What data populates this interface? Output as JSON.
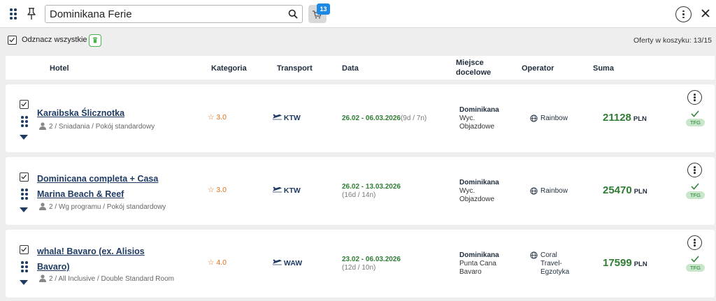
{
  "search": {
    "value": "Dominikana Ferie",
    "placeholder": ""
  },
  "cart": {
    "badge": "13"
  },
  "toolbar": {
    "select_all_label": "Odznacz wszystkie",
    "basket_count": "Oferty w koszyku: 13/15"
  },
  "table": {
    "headers": {
      "hotel": "Hotel",
      "category": "Kategoria",
      "transport": "Transport",
      "date": "Data",
      "destination": "Miejsce docelowe",
      "operator": "Operator",
      "sum": "Suma"
    }
  },
  "offers": [
    {
      "selected": true,
      "hotel_name": "Karaibska Ślicznotka",
      "details": "2 / Sniadania / Pokój standardowy",
      "category": "3.0",
      "transport": "KTW",
      "date_range": "26.02 - 06.03.2026",
      "duration": "(9d / 7n)",
      "destination": {
        "country": "Dominikana",
        "lines": [
          "Wyc.",
          "Objazdowe"
        ]
      },
      "operator": "Rainbow",
      "price": "21128",
      "currency": "PLN",
      "badge": "TFG"
    },
    {
      "selected": true,
      "hotel_name": "Dominicana completa + Casa Marina Beach & Reef",
      "details": "2 / Wg programu / Pokój standardowy",
      "category": "3.0",
      "transport": "KTW",
      "date_range": "26.02 - 13.03.2026",
      "duration": "(16d / 14n)",
      "destination": {
        "country": "Dominikana",
        "lines": [
          "Wyc.",
          "Objazdowe"
        ]
      },
      "operator": "Rainbow",
      "price": "25470",
      "currency": "PLN",
      "badge": "TFG"
    },
    {
      "selected": true,
      "hotel_name": "whala! Bavaro (ex. Alisios Bavaro)",
      "details": "2 / All Inclusive / Double Standard Room",
      "category": "4.0",
      "transport": "WAW",
      "date_range": "23.02 - 06.03.2026",
      "duration": "(12d / 10n)",
      "destination": {
        "country": "Dominikana",
        "lines": [
          "Punta Cana",
          "Bavaro"
        ]
      },
      "operator": "Coral Travel-Egzotyka",
      "operator_lines": [
        "Coral",
        "Travel-",
        "Egzotyka"
      ],
      "price": "17599",
      "currency": "PLN",
      "badge": "TFG"
    }
  ],
  "colors": {
    "accent": "#1f3b64",
    "price": "#2e7d32",
    "star": "#e0701a",
    "badge_blue": "#1e88e5",
    "tfg_bg": "#c8e6c9"
  },
  "icons": [
    "grid-icon",
    "pin-icon",
    "search-icon",
    "cart-icon",
    "kebab-menu-icon",
    "close-icon",
    "trash-icon",
    "drag-handle-icon",
    "chevron-down-icon",
    "star-icon",
    "plane-icon",
    "globe-icon",
    "check-icon",
    "person-icon"
  ]
}
